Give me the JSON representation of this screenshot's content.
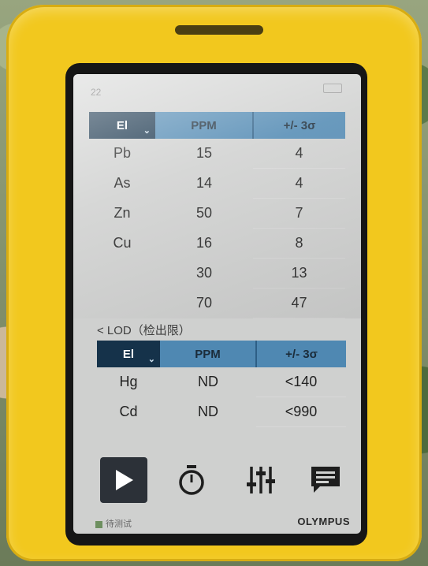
{
  "status_bar": {
    "time": "22"
  },
  "results_table": {
    "headers": {
      "element": "El",
      "ppm": "PPM",
      "error": "+/- 3σ"
    },
    "rows": [
      {
        "element": "Pb",
        "ppm": "15",
        "error": "4"
      },
      {
        "element": "As",
        "ppm": "14",
        "error": "4"
      },
      {
        "element": "Zn",
        "ppm": "50",
        "error": "7"
      },
      {
        "element": "Cu",
        "ppm": "16",
        "error": "8"
      },
      {
        "element": "",
        "ppm": "30",
        "error": "13"
      },
      {
        "element": "",
        "ppm": "70",
        "error": "47"
      }
    ]
  },
  "lod_section": {
    "caption": "< LOD（检出限）",
    "headers": {
      "element": "El",
      "ppm": "PPM",
      "error": "+/- 3σ"
    },
    "rows": [
      {
        "element": "Hg",
        "ppm": "ND",
        "error": "<140"
      },
      {
        "element": "Cd",
        "ppm": "ND",
        "error": "<990"
      }
    ]
  },
  "toolbar": {
    "icons": [
      "play-icon",
      "stopwatch-icon",
      "sliders-icon",
      "message-icon"
    ]
  },
  "footer": {
    "status": "待测试",
    "brand": "OLYMPUS"
  },
  "colors": {
    "case": "#f2c81e",
    "header_dark": "#15324a",
    "header_blue": "#4f88b2",
    "screen_bg": "#cfd0cf"
  }
}
